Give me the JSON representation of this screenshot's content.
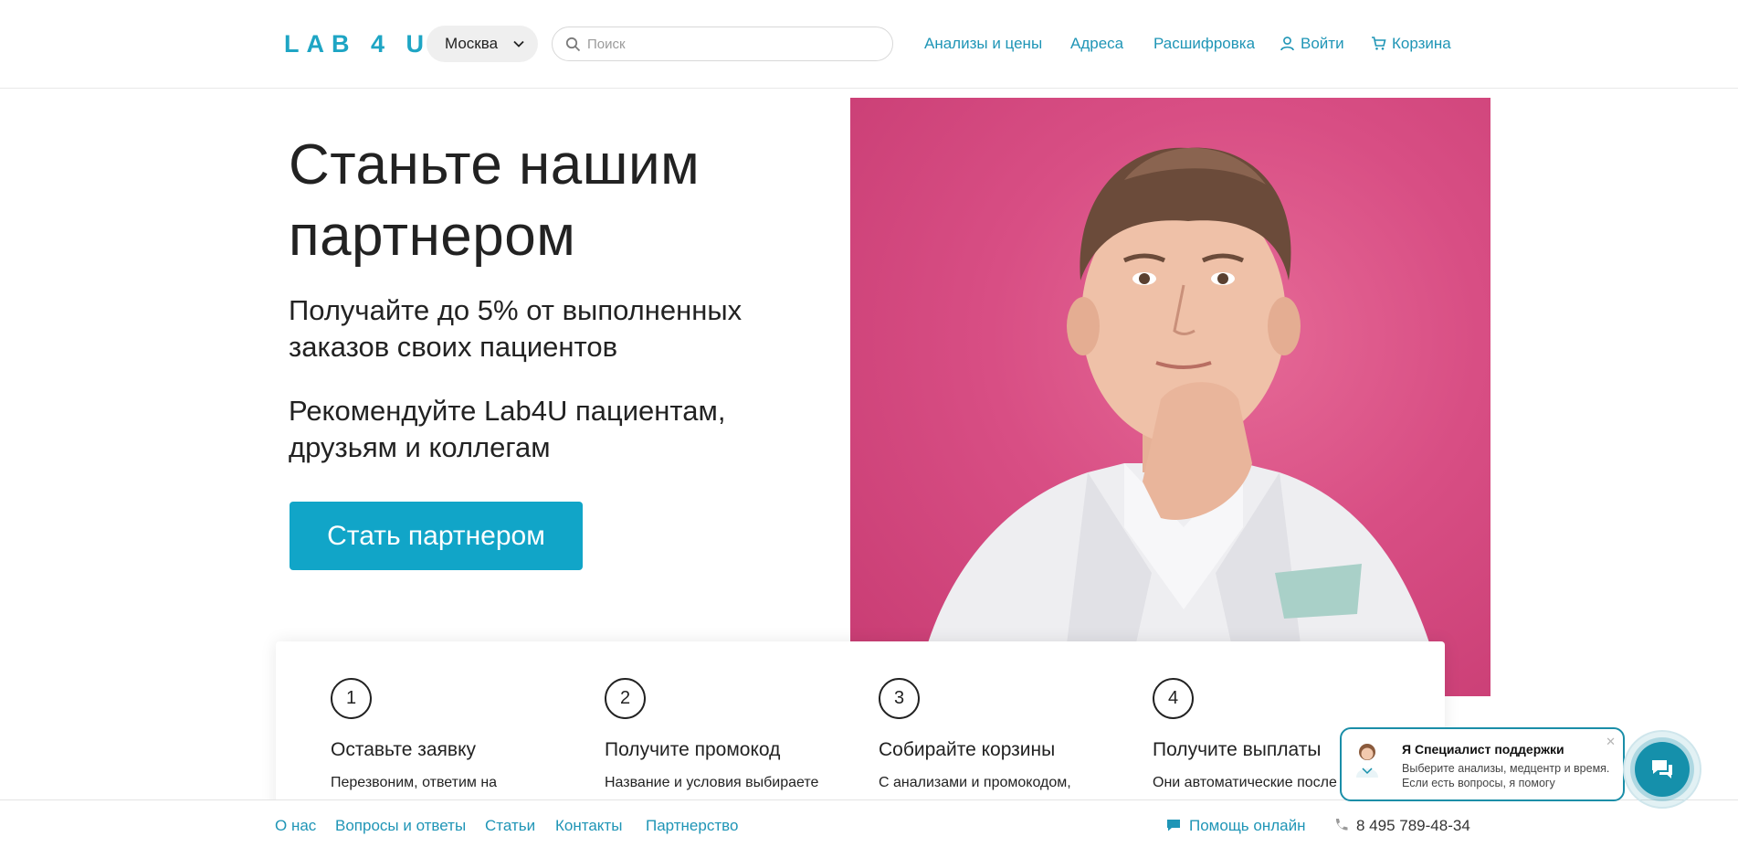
{
  "header": {
    "logo": "LAB 4 U",
    "city": "Москва",
    "search_placeholder": "Поиск",
    "nav": {
      "analyses": "Анализы и цены",
      "addresses": "Адреса",
      "decoding": "Расшифровка",
      "login": "Войти",
      "cart": "Корзина"
    }
  },
  "hero": {
    "title_line1": "Станьте нашим",
    "title_line2": "партнером",
    "sub1_line1": "Получайте до 5% от выполненных",
    "sub1_line2": "заказов своих пациентов",
    "sub2_line1": "Рекомендуйте Lab4U пациентам,",
    "sub2_line2": "друзьям и коллегам",
    "cta": "Стать партнером"
  },
  "steps": [
    {
      "num": "1",
      "title": "Оставьте заявку",
      "desc": "Перезвоним, ответим на"
    },
    {
      "num": "2",
      "title": "Получите промокод",
      "desc": "Название и условия выбираете"
    },
    {
      "num": "3",
      "title": "Собирайте корзины",
      "desc": "С анализами и промокодом,"
    },
    {
      "num": "4",
      "title": "Получите выплаты",
      "desc": "Они автоматические после"
    }
  ],
  "footer": {
    "about": "О нас",
    "faq": "Вопросы и ответы",
    "articles": "Статьи",
    "contacts": "Контакты",
    "partnership": "Партнерство",
    "help_online": "Помощь онлайн",
    "phone": "8 495 789-48-34"
  },
  "chat": {
    "title": "Я Специалист поддержки",
    "message": "Выберите анализы, медцентр и время. Если есть вопросы, я помогу"
  },
  "colors": {
    "brand": "#1ea5c4",
    "cta": "#11a5c8",
    "link": "#1f95b6",
    "photo_bg": "#d84e84"
  }
}
